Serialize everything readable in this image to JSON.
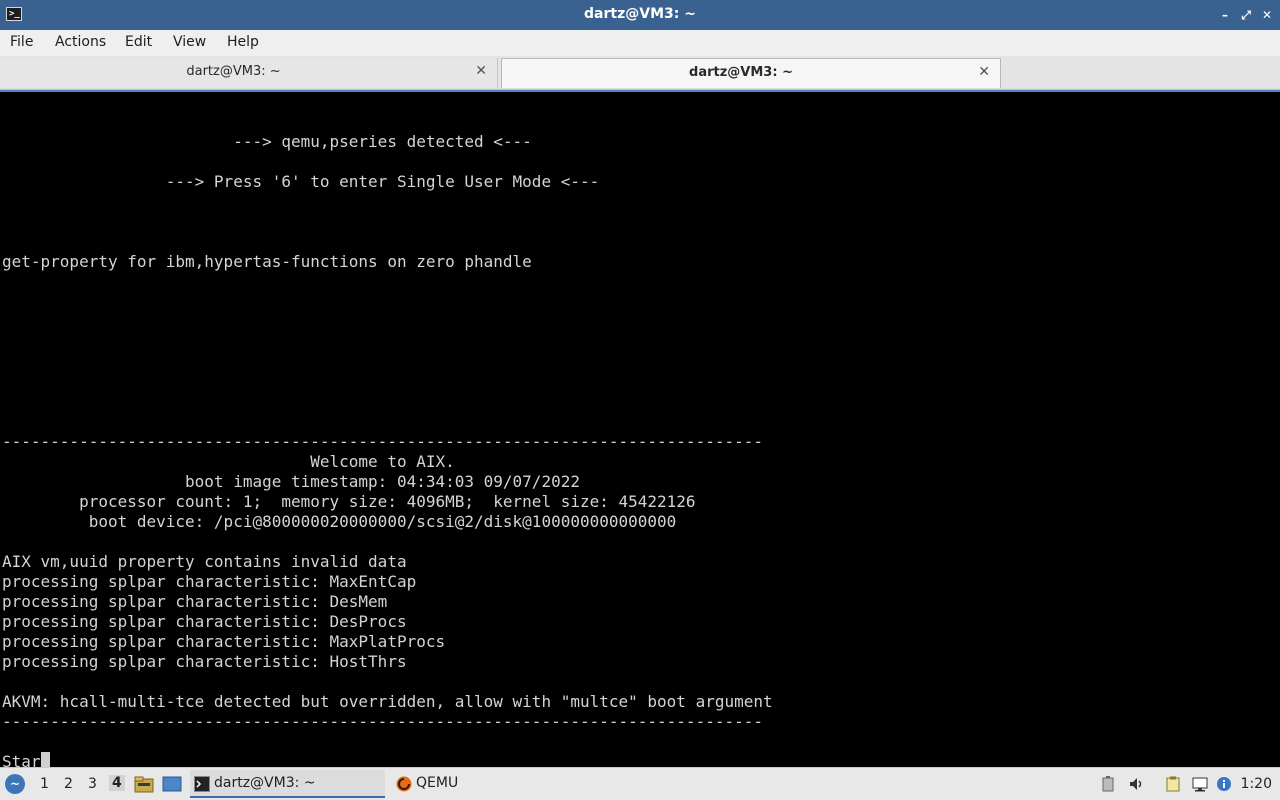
{
  "window": {
    "title": "dartz@VM3: ~",
    "minimize_glyph": "–",
    "restore_glyph": "⤢",
    "close_glyph": "✕",
    "app_icon_glyph": ">_"
  },
  "menu": {
    "file": "File",
    "actions": "Actions",
    "edit": "Edit",
    "view": "View",
    "help": "Help"
  },
  "tabs": [
    {
      "label": "dartz@VM3: ~",
      "active": false
    },
    {
      "label": "dartz@VM3: ~",
      "active": true
    }
  ],
  "tab_close_glyph": "✕",
  "terminal": {
    "lines": [
      {
        "row": 1,
        "text": "                        ---> qemu,pseries detected <---"
      },
      {
        "row": 3,
        "text": "                 ---> Press '6' to enter Single User Mode <---"
      },
      {
        "row": 7,
        "text": "get-property for ibm,hypertas-functions on zero phandle"
      },
      {
        "row": 16,
        "text": "-------------------------------------------------------------------------------"
      },
      {
        "row": 17,
        "text": "                                Welcome to AIX."
      },
      {
        "row": 18,
        "text": "                   boot image timestamp: 04:34:03 09/07/2022"
      },
      {
        "row": 19,
        "text": "        processor count: 1;  memory size: 4096MB;  kernel size: 45422126"
      },
      {
        "row": 20,
        "text": "         boot device: /pci@800000020000000/scsi@2/disk@100000000000000"
      },
      {
        "row": 22,
        "text": "AIX vm,uuid property contains invalid data"
      },
      {
        "row": 23,
        "text": "processing splpar characteristic: MaxEntCap"
      },
      {
        "row": 24,
        "text": "processing splpar characteristic: DesMem"
      },
      {
        "row": 25,
        "text": "processing splpar characteristic: DesProcs"
      },
      {
        "row": 26,
        "text": "processing splpar characteristic: MaxPlatProcs"
      },
      {
        "row": 27,
        "text": "processing splpar characteristic: HostThrs"
      },
      {
        "row": 29,
        "text": "AKVM: hcall-multi-tce detected but overridden, allow with \"multce\" boot argument"
      },
      {
        "row": 30,
        "text": "-------------------------------------------------------------------------------"
      }
    ],
    "prompt_text": "Star"
  },
  "taskbar": {
    "workspaces": [
      "1",
      "2",
      "3",
      "4"
    ],
    "active_workspace": "4",
    "tasks": [
      {
        "label": "dartz@VM3: ~",
        "icon": "terminal-icon",
        "active": true
      },
      {
        "label": "QEMU",
        "icon": "qemu-icon",
        "active": false
      }
    ],
    "clock": "1:20"
  },
  "colors": {
    "titlebar": "#3a6290",
    "terminal_bg": "#000000",
    "terminal_fg": "#d4d4d4",
    "accent": "#4f84c8"
  }
}
